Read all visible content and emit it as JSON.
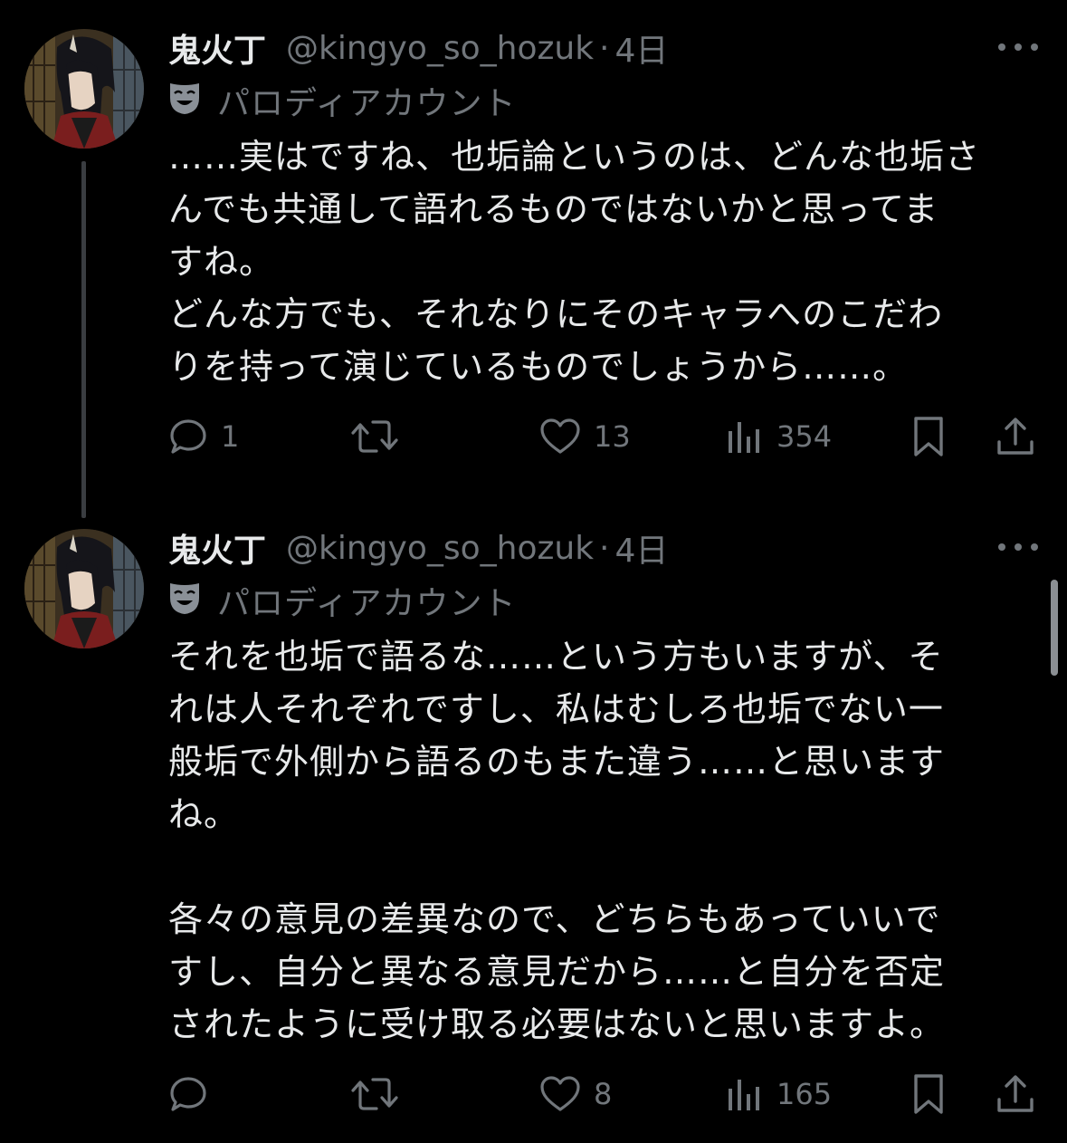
{
  "colors": {
    "background": "#000000",
    "text_primary": "#e7e9ea",
    "text_secondary": "#71767b"
  },
  "tweets": [
    {
      "author": {
        "display_name": "鬼火丁",
        "handle": "@kingyo_so_hozuk",
        "avatar": "character-portrait-avatar"
      },
      "separator": "·",
      "time": "4日",
      "label_icon": "parody-mask-icon",
      "label_text": "パロディアカウント",
      "text": "……実はですね、也垢論というのは、どんな也垢さ\nんでも共通して語れるものではないかと思ってま\nすね。\nどんな方でも、それなりにそのキャラへのこだわ\nりを持って演じているものでしょうから……。",
      "actions": {
        "reply_count": "1",
        "retweet_count": "",
        "like_count": "13",
        "view_count": "354"
      }
    },
    {
      "author": {
        "display_name": "鬼火丁",
        "handle": "@kingyo_so_hozuk",
        "avatar": "character-portrait-avatar"
      },
      "separator": "·",
      "time": "4日",
      "label_icon": "parody-mask-icon",
      "label_text": "パロディアカウント",
      "text": "それを也垢で語るな……という方もいますが、そ\nれは人それぞれですし、私はむしろ也垢でない一\n般垢で外側から語るのもまた違う……と思います\nね。\n\n各々の意見の差異なので、どちらもあっていいで\nすし、自分と異なる意見だから……と自分を否定\nされたように受け取る必要はないと思いますよ。",
      "actions": {
        "reply_count": "",
        "retweet_count": "",
        "like_count": "8",
        "view_count": "165"
      }
    }
  ]
}
